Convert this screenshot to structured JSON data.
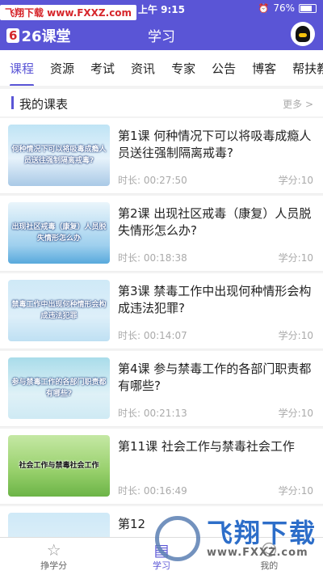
{
  "statusbar": {
    "time": "上午 9:15",
    "battery": "76%"
  },
  "watermark_top": "飞翔下载 www.FXXZ.com",
  "header": {
    "logo_badge": "6",
    "logo_text": "26课堂",
    "title": "学习"
  },
  "tabs": [
    "课程",
    "资源",
    "考试",
    "资讯",
    "专家",
    "公告",
    "博客",
    "帮扶教"
  ],
  "section": {
    "title": "我的课表",
    "more": "更多 >"
  },
  "courses": [
    {
      "title": "第1课 何种情况下可以将吸毒成瘾人员送往强制隔离戒毒?",
      "thumb": "何种情况下可以将吸毒成瘾人员送往强制隔离戒毒?",
      "duration": "时长:   00:27:50",
      "score": "学分:10"
    },
    {
      "title": "第2课 出现社区戒毒（康复）人员脱失情形怎么办?",
      "thumb": "出现社区戒毒（康复）人员脱失情形怎么办",
      "duration": "时长:   00:18:38",
      "score": "学分:10"
    },
    {
      "title": "第3课 禁毒工作中出现何种情形会构成违法犯罪?",
      "thumb": "禁毒工作中出现何种情形会构成违法犯罪",
      "duration": "时长:   00:14:07",
      "score": "学分:10"
    },
    {
      "title": "第4课 参与禁毒工作的各部门职责都有哪些?",
      "thumb": "参与禁毒工作的各部门职责都有哪些?",
      "duration": "时长:   00:21:13",
      "score": "学分:10"
    },
    {
      "title": "第11课 社会工作与禁毒社会工作",
      "thumb": "社会工作与禁毒社会工作",
      "duration": "时长:   00:16:49",
      "score": "学分:10"
    },
    {
      "title": "第12",
      "thumb": "",
      "duration": "",
      "score": ""
    }
  ],
  "bottomnav": {
    "items": [
      "挣学分",
      "学习",
      "我的"
    ],
    "active": 1
  },
  "watermark_bottom": {
    "big": "飞翔下载",
    "url": "www.FXXZ.com"
  },
  "colors": {
    "brand": "#5a55d6"
  }
}
